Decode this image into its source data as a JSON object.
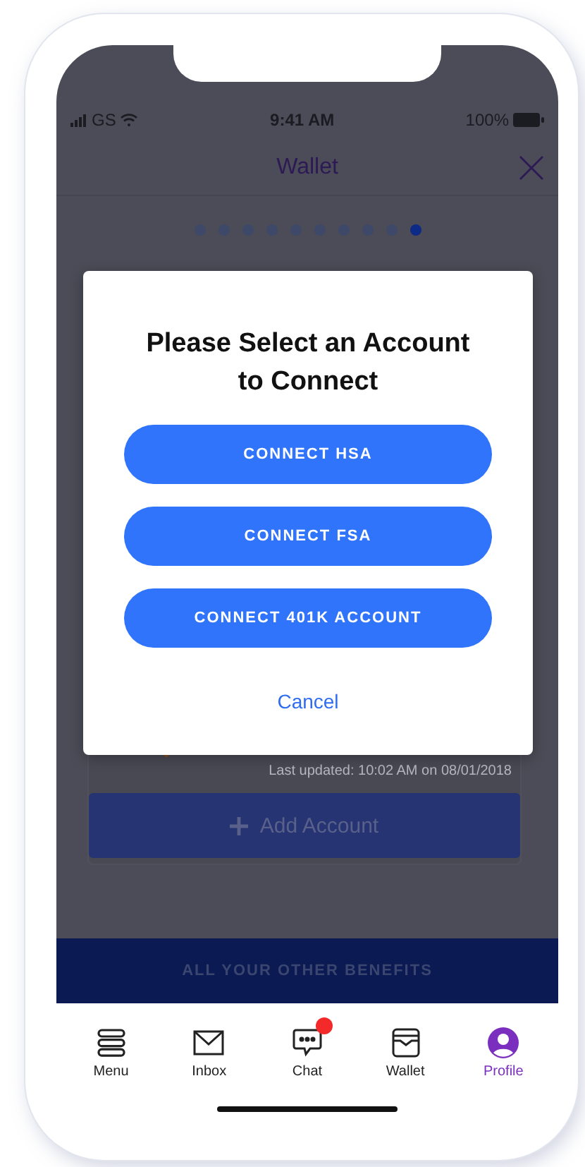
{
  "status_bar": {
    "carrier": "GS",
    "time": "9:41 AM",
    "battery": "100%"
  },
  "header": {
    "title": "Wallet"
  },
  "pager": [
    {
      "selected": false
    },
    {
      "selected": false
    },
    {
      "selected": false
    },
    {
      "selected": false
    },
    {
      "selected": false
    },
    {
      "selected": false
    },
    {
      "selected": false
    },
    {
      "selected": false
    },
    {
      "selected": false
    },
    {
      "selected": true
    }
  ],
  "account_card": {
    "last_updated": "Last updated: 10:02 AM on 08/01/2018",
    "add_button": "Add Account"
  },
  "dialog": {
    "title": "Please Select an Account to Connect",
    "options": [
      "CONNECT HSA",
      "CONNECT FSA",
      "CONNECT 401K ACCOUNT"
    ],
    "cancel": "Cancel"
  },
  "benefits_bar": "ALL YOUR OTHER BENEFITS",
  "tab_bar": [
    {
      "kind": "menu",
      "label": "Menu",
      "selected": false,
      "badge": false
    },
    {
      "kind": "inbox",
      "label": "Inbox",
      "selected": false,
      "badge": false
    },
    {
      "kind": "chat",
      "label": "Chat",
      "selected": false,
      "badge": true
    },
    {
      "kind": "wallet",
      "label": "Wallet",
      "selected": false,
      "badge": false
    },
    {
      "kind": "profile",
      "label": "Profile",
      "selected": true,
      "badge": false
    }
  ]
}
